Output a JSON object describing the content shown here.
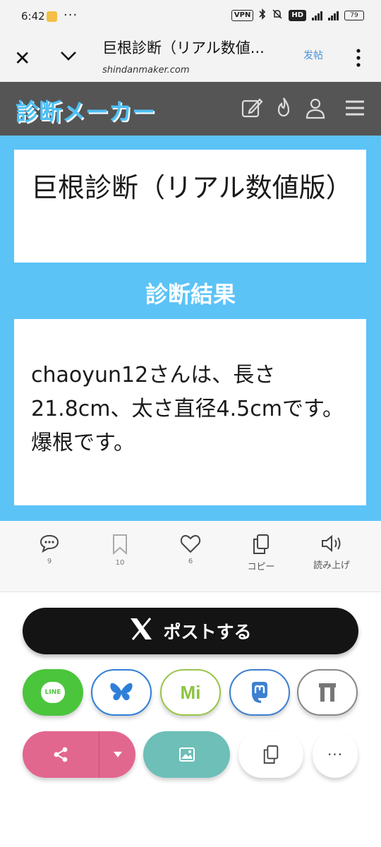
{
  "status": {
    "time": "6:42",
    "vpn": "VPN",
    "hd": "HD",
    "battery": "79"
  },
  "browser": {
    "title": "巨根診断（リアル数値...",
    "url": "shindanmaker.com",
    "post_label": "发帖"
  },
  "site": {
    "logo": "診断メーカー"
  },
  "diagnosis": {
    "title": "巨根診断（リアル数値版）",
    "result_label": "診断結果",
    "result_text": "chaoyun12さんは、長さ21.8cm、太さ直径4.5cmです。爆根です。"
  },
  "actions": [
    {
      "icon": "comment-icon",
      "label": "9"
    },
    {
      "icon": "bookmark-icon",
      "label": "10"
    },
    {
      "icon": "heart-icon",
      "label": "6"
    },
    {
      "icon": "copy-icon",
      "label": "コピー"
    },
    {
      "icon": "speaker-icon",
      "label": "読み上げ"
    }
  ],
  "post_button": {
    "label": "ポストする"
  },
  "share": {
    "line_label": "LINE",
    "misskey_label": "Mi",
    "more_label": "···"
  },
  "colors": {
    "accent": "#5cc3f7",
    "header": "#555555",
    "line": "#4bc53c",
    "share_pink": "#e2678f",
    "image_teal": "#6dbfb8"
  }
}
